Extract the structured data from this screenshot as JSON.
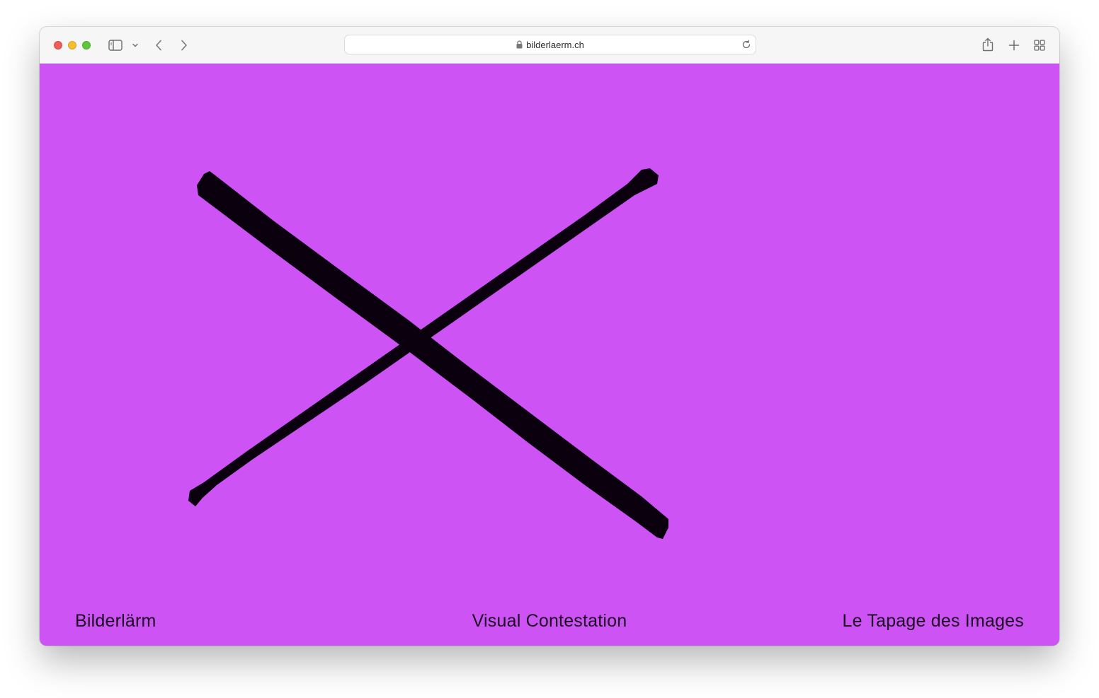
{
  "browser": {
    "url": "bilderlaerm.ch",
    "icons": {
      "close": "close-window-icon",
      "minimize": "minimize-window-icon",
      "maximize": "maximize-window-icon",
      "sidebar": "sidebar-icon",
      "sidebar_menu": "chevron-down-icon",
      "back": "chevron-left-icon",
      "forward": "chevron-right-icon",
      "lock": "lock-icon",
      "reload": "reload-icon",
      "share": "share-icon",
      "new_tab": "plus-icon",
      "tab_overview": "grid-icon"
    }
  },
  "page": {
    "background_color": "#cd53f5",
    "art": "hand-painted-cross-mark",
    "art_color": "#0a000e",
    "footer": {
      "left": "Bilderlärm",
      "center": "Visual Contestation",
      "right": "Le Tapage des Images"
    }
  }
}
